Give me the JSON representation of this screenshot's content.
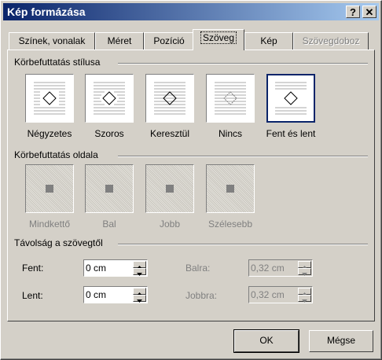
{
  "title": "Kép formázása",
  "title_buttons": {
    "help": "?",
    "close": "✕"
  },
  "tabs": [
    {
      "label": "Színek, vonalak",
      "active": false,
      "disabled": false
    },
    {
      "label": "Méret",
      "active": false,
      "disabled": false
    },
    {
      "label": "Pozíció",
      "active": false,
      "disabled": false
    },
    {
      "label": "Szöveg",
      "active": true,
      "disabled": false
    },
    {
      "label": "Kép",
      "active": false,
      "disabled": false
    },
    {
      "label": "Szövegdoboz",
      "active": false,
      "disabled": true
    }
  ],
  "wrap_style": {
    "heading": "Körbefuttatás stílusa",
    "options": [
      {
        "label": "Négyzetes",
        "icon": "wrap-square-icon",
        "selected": false
      },
      {
        "label": "Szoros",
        "icon": "wrap-tight-icon",
        "selected": false
      },
      {
        "label": "Keresztül",
        "icon": "wrap-through-icon",
        "selected": false
      },
      {
        "label": "Nincs",
        "icon": "wrap-none-icon",
        "selected": false
      },
      {
        "label": "Fent és lent",
        "icon": "wrap-top-bottom-icon",
        "selected": true
      }
    ]
  },
  "wrap_side": {
    "heading": "Körbefuttatás oldala",
    "options": [
      {
        "label": "Mindkettő",
        "icon": "wrap-both-sides-icon"
      },
      {
        "label": "Bal",
        "icon": "wrap-left-icon"
      },
      {
        "label": "Jobb",
        "icon": "wrap-right-icon"
      },
      {
        "label": "Szélesebb",
        "icon": "wrap-largest-side-icon"
      }
    ]
  },
  "distance": {
    "heading": "Távolság a szövegtől",
    "top": {
      "label": "Fent:",
      "value": "0 cm"
    },
    "bottom": {
      "label": "Lent:",
      "value": "0 cm"
    },
    "left": {
      "label": "Balra:",
      "value": "0,32 cm"
    },
    "right": {
      "label": "Jobbra:",
      "value": "0,32 cm"
    }
  },
  "buttons": {
    "ok": "OK",
    "cancel": "Mégse"
  }
}
